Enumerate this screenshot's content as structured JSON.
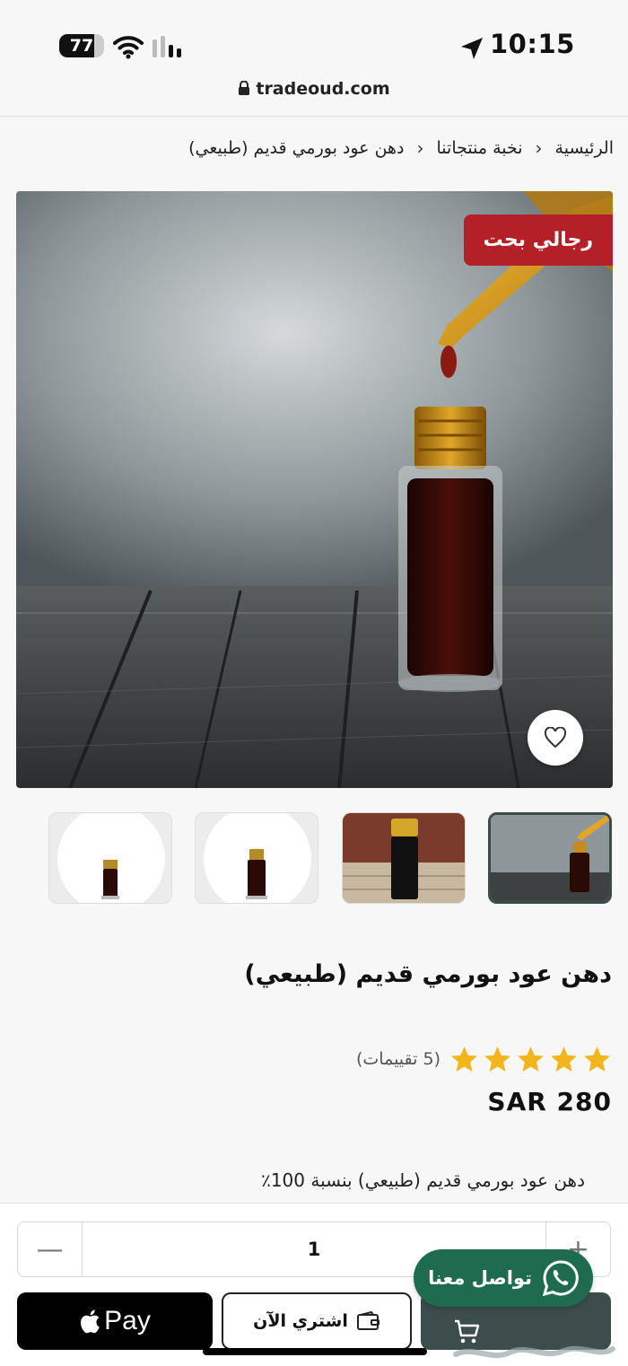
{
  "status_bar": {
    "battery": "77",
    "battery_level": 0.77,
    "time": "10:15"
  },
  "browser": {
    "url": "tradeoud.com"
  },
  "breadcrumb": {
    "items": [
      "الرئيسية",
      "نخبة منتجاتنا",
      "دهن عود بورمي قديم (طبيعي)"
    ],
    "separator": "‹"
  },
  "product": {
    "badge": "رجالي بحت",
    "title": "دهن عود بورمي قديم (طبيعي)",
    "rating": 5,
    "rating_count_text": "(5 تقييمات)",
    "price": "SAR 280",
    "description": "دهن عود بورمي قديم (طبيعي) بنسبة 100٪",
    "thumbnails_count": 4,
    "active_thumbnail": 1
  },
  "purchase": {
    "quantity": "1",
    "minus": "—",
    "plus": "+",
    "buy_now_label": "اشتري الآن",
    "apple_pay_label": "Pay",
    "whatsapp_label": "تواصل معنا"
  },
  "colors": {
    "badge_red": "#b42027",
    "star_yellow": "#f2b51c",
    "cart_dark": "#3c4d4c",
    "whatsapp_green": "#1f6b50"
  }
}
